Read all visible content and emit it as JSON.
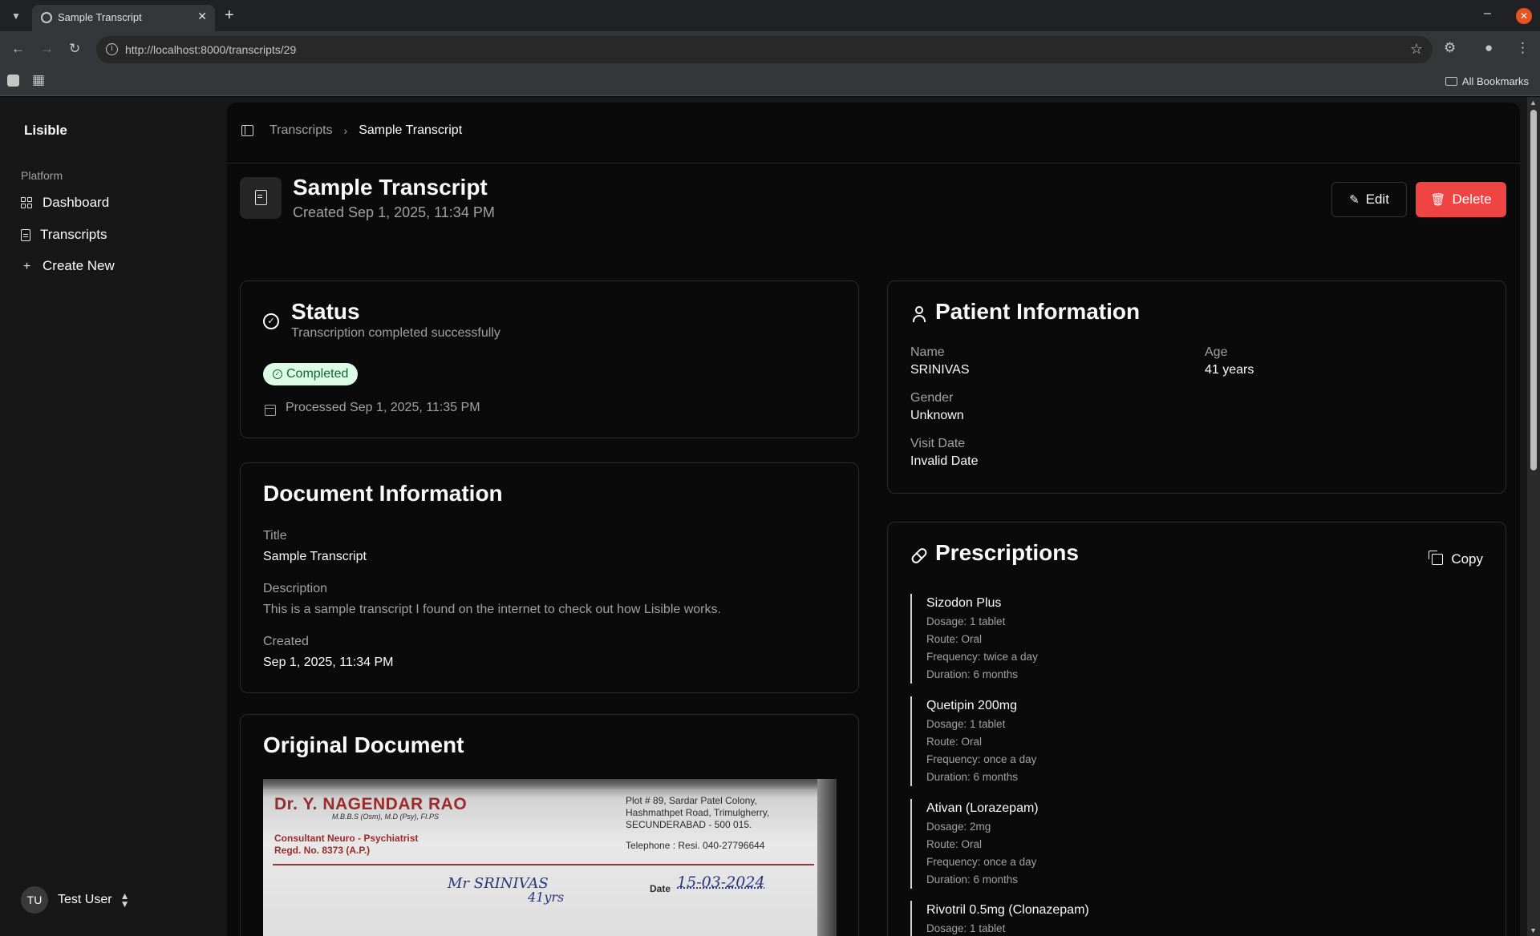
{
  "browser": {
    "tab_title": "Sample Transcript",
    "url": "http://localhost:8000/transcripts/29",
    "bookmarks_label": "All Bookmarks"
  },
  "sidebar": {
    "brand": "Lisible",
    "group_label": "Platform",
    "items": [
      {
        "label": "Dashboard",
        "icon": "grid-icon"
      },
      {
        "label": "Transcripts",
        "icon": "document-icon"
      },
      {
        "label": "Create New",
        "icon": "plus-icon"
      }
    ],
    "user": {
      "initials": "TU",
      "name": "Test User"
    }
  },
  "breadcrumb": {
    "parent": "Transcripts",
    "current": "Sample Transcript"
  },
  "header": {
    "title": "Sample Transcript",
    "subtitle": "Created Sep 1, 2025, 11:34 PM",
    "edit_label": "Edit",
    "delete_label": "Delete"
  },
  "status": {
    "title": "Status",
    "description": "Transcription completed successfully",
    "badge": "Completed",
    "processed": "Processed Sep 1, 2025, 11:35 PM",
    "badge_color": "#dcfce7"
  },
  "document_info": {
    "title": "Document Information",
    "title_label": "Title",
    "title_value": "Sample Transcript",
    "description_label": "Description",
    "description_value": "This is a sample transcript I found on the internet to check out how Lisible works.",
    "created_label": "Created",
    "created_value": "Sep 1, 2025, 11:34 PM"
  },
  "original_document": {
    "title": "Original Document",
    "scan": {
      "doctor_name": "Dr. Y. NAGENDAR RAO",
      "degrees": "M.B.B.S (Osm), M.D (Psy), FI.PS",
      "specialty": "Consultant Neuro - Psychiatrist",
      "regd": "Regd. No. 8373 (A.P.)",
      "address_1": "Plot # 89, Sardar Patel Colony,",
      "address_2": "Hashmathpet Road, Trimulgherry,",
      "address_3": "SECUNDERABAD - 500 015.",
      "telephone": "Telephone : Resi. 040-27796644",
      "patient_hw": "Mr SRINIVAS",
      "age_hw": "41yrs",
      "date_label": "Date",
      "date_hw": "15-03-2024"
    }
  },
  "patient": {
    "title": "Patient Information",
    "name_label": "Name",
    "name_value": "SRINIVAS",
    "age_label": "Age",
    "age_value": "41 years",
    "gender_label": "Gender",
    "gender_value": "Unknown",
    "visit_label": "Visit Date",
    "visit_value": "Invalid Date"
  },
  "prescriptions": {
    "title": "Prescriptions",
    "copy_label": "Copy",
    "items": [
      {
        "name": "Sizodon Plus",
        "dosage": "Dosage: 1 tablet",
        "route": "Route: Oral",
        "frequency": "Frequency: twice a day",
        "duration": "Duration: 6 months"
      },
      {
        "name": "Quetipin 200mg",
        "dosage": "Dosage: 1 tablet",
        "route": "Route: Oral",
        "frequency": "Frequency: once a day",
        "duration": "Duration: 6 months"
      },
      {
        "name": "Ativan (Lorazepam)",
        "dosage": "Dosage: 2mg",
        "route": "Route: Oral",
        "frequency": "Frequency: once a day",
        "duration": "Duration: 6 months"
      },
      {
        "name": "Rivotril 0.5mg (Clonazepam)",
        "dosage": "Dosage: 1 tablet",
        "route": "",
        "frequency": "",
        "duration": ""
      }
    ]
  },
  "colors": {
    "delete": "#ef4444",
    "accent_badge_text": "#166534"
  }
}
